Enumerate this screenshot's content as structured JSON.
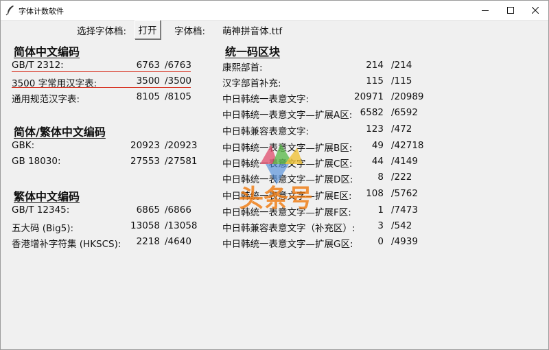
{
  "window": {
    "title": "字体计数软件"
  },
  "toolbar": {
    "select_label": "选择字体档:",
    "open_button": "打开",
    "font_file_label": "字体档:",
    "font_file_value": "萌神拼音体.ttf"
  },
  "sections": {
    "simplified": {
      "heading": "简体中文编码",
      "rows": [
        {
          "label": "GB/T 2312:",
          "count": "6763",
          "total": "/6763"
        },
        {
          "label": "3500 字常用汉字表:",
          "count": "3500",
          "total": "/3500"
        },
        {
          "label": "通用规范汉字表:",
          "count": "8105",
          "total": "/8105"
        }
      ]
    },
    "simp_trad": {
      "heading": "简体/繁体中文编码",
      "rows": [
        {
          "label": "GBK:",
          "count": "20923",
          "total": "/20923"
        },
        {
          "label": "GB 18030:",
          "count": "27553",
          "total": "/27581"
        }
      ]
    },
    "traditional": {
      "heading": "繁体中文编码",
      "rows": [
        {
          "label": "GB/T 12345:",
          "count": "6865",
          "total": "/6866"
        },
        {
          "label": "五大码 (Big5):",
          "count": "13058",
          "total": "/13058"
        },
        {
          "label": "香港增补字符集 (HKSCS):",
          "count": "2218",
          "total": "/4640"
        }
      ]
    },
    "unicode": {
      "heading": "统一码区块",
      "rows": [
        {
          "label": "康熙部首:",
          "count": "214",
          "total": "/214"
        },
        {
          "label": "汉字部首补充:",
          "count": "115",
          "total": "/115"
        },
        {
          "label": "中日韩统一表意文字:",
          "count": "20971",
          "total": "/20989"
        },
        {
          "label": "中日韩统一表意文字—扩展A区:",
          "count": "6582",
          "total": "/6592"
        },
        {
          "label": "中日韩兼容表意文字:",
          "count": "123",
          "total": "/472"
        },
        {
          "label": "中日韩统一表意文字—扩展B区:",
          "count": "49",
          "total": "/42718"
        },
        {
          "label": "中日韩统一表意文字—扩展C区:",
          "count": "44",
          "total": "/4149"
        },
        {
          "label": "中日韩统一表意文字—扩展D区:",
          "count": "8",
          "total": "/222"
        },
        {
          "label": "中日韩统一表意文字—扩展E区:",
          "count": "108",
          "total": "/5762"
        },
        {
          "label": "中日韩统一表意文字—扩展F区:",
          "count": "1",
          "total": "/7473"
        },
        {
          "label": "中日韩兼容表意文字（补充区）:",
          "count": "3",
          "total": "/542"
        },
        {
          "label": "中日韩统一表意文字—扩展G区:",
          "count": "0",
          "total": "/4939"
        }
      ]
    }
  },
  "watermark": {
    "text": "头条号"
  },
  "colors": {
    "underline_red": "#d83a2a",
    "watermark_orange": "#f07a10"
  }
}
